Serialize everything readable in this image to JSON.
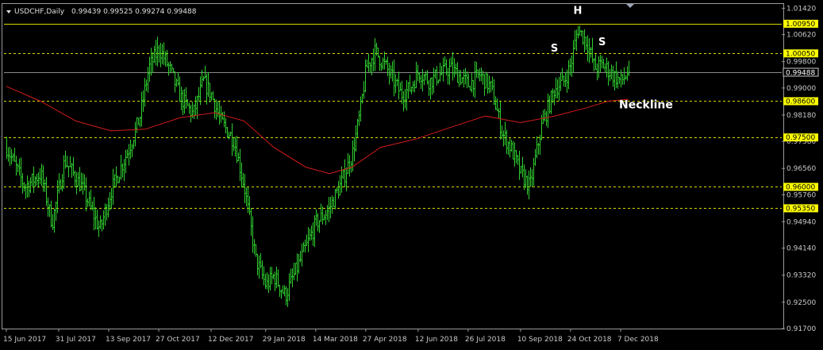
{
  "header": {
    "symbol_label": "USDCHF,Daily",
    "ohlc_label": "0.99439 0.99525 0.99274 0.99488"
  },
  "chart_data": {
    "type": "candlestick",
    "symbol": "USDCHF",
    "timeframe": "Daily",
    "ohlc": {
      "open": 0.99439,
      "high": 0.99525,
      "low": 0.99274,
      "close": 0.99488
    },
    "y_range": [
      0.917,
      1.0155
    ],
    "y_ticks": [
      "1.01420",
      "1.00620",
      "0.99800",
      "0.99000",
      "0.98180",
      "0.97380",
      "0.96560",
      "0.95760",
      "0.94940",
      "0.94140",
      "0.93320",
      "0.92500",
      "0.91700"
    ],
    "x_labels": [
      "15 Jun 2017",
      "31 Jul 2017",
      "13 Sep 2017",
      "27 Oct 2017",
      "12 Dec 2017",
      "29 Jan 2018",
      "14 Mar 2018",
      "27 Apr 2018",
      "12 Jun 2018",
      "26 Jul 2018",
      "10 Sep 2018",
      "24 Oct 2018",
      "7 Dec 2018"
    ],
    "levels": [
      {
        "value": 1.0095,
        "label": "1.00950",
        "style": "solid",
        "color": "#d8d800"
      },
      {
        "value": 1.0005,
        "label": "1.00050",
        "style": "dashed",
        "color": "#d8d800"
      },
      {
        "value": 0.986,
        "label": "0.98600",
        "style": "dashed",
        "color": "#d8d800"
      },
      {
        "value": 0.975,
        "label": "0.97500",
        "style": "dashed",
        "color": "#d8d800"
      },
      {
        "value": 0.96,
        "label": "0.96000",
        "style": "dashed",
        "color": "#d8d800"
      },
      {
        "value": 0.9535,
        "label": "0.95350",
        "style": "dashed",
        "color": "#d8d800"
      }
    ],
    "current_price": {
      "value": 0.99488,
      "label": "0.99488"
    },
    "annotations": [
      {
        "text": "H",
        "date": "30 Oct 2018",
        "price": 1.0125
      },
      {
        "text": "S",
        "date": "10 Oct 2018",
        "price": 1.001
      },
      {
        "text": "S",
        "date": "21 Nov 2018",
        "price": 1.003
      },
      {
        "text": "Neckline",
        "date": "14 Dec 2018",
        "price": 0.9838
      }
    ],
    "price_path": [
      [
        "15 Jun 2017",
        0.972
      ],
      [
        "1 Jul 2017",
        0.96
      ],
      [
        "15 Jul 2017",
        0.964
      ],
      [
        "25 Jul 2017",
        0.949
      ],
      [
        "5 Aug 2017",
        0.968
      ],
      [
        "20 Aug 2017",
        0.96
      ],
      [
        "5 Sep 2017",
        0.947
      ],
      [
        "15 Sep 2017",
        0.959
      ],
      [
        "1 Oct 2017",
        0.972
      ],
      [
        "10 Oct 2017",
        0.981
      ],
      [
        "18 Oct 2017",
        0.996
      ],
      [
        "27 Oct 2017",
        1.002
      ],
      [
        "5 Nov 2017",
        0.996
      ],
      [
        "15 Nov 2017",
        0.987
      ],
      [
        "26 Nov 2017",
        0.982
      ],
      [
        "5 Dec 2017",
        0.992
      ],
      [
        "12 Dec 2017",
        0.988
      ],
      [
        "20 Dec 2017",
        0.98
      ],
      [
        "1 Jan 2018",
        0.974
      ],
      [
        "10 Jan 2018",
        0.96
      ],
      [
        "20 Jan 2018",
        0.938
      ],
      [
        "29 Jan 2018",
        0.93
      ],
      [
        "5 Feb 2018",
        0.933
      ],
      [
        "15 Feb 2018",
        0.927
      ],
      [
        "26 Feb 2018",
        0.936
      ],
      [
        "8 Mar 2018",
        0.944
      ],
      [
        "14 Mar 2018",
        0.949
      ],
      [
        "25 Mar 2018",
        0.953
      ],
      [
        "5 Apr 2018",
        0.961
      ],
      [
        "15 Apr 2018",
        0.97
      ],
      [
        "22 Apr 2018",
        0.983
      ],
      [
        "27 Apr 2018",
        0.996
      ],
      [
        "5 May 2018",
        1.001
      ],
      [
        "15 May 2018",
        0.996
      ],
      [
        "28 May 2018",
        0.988
      ],
      [
        "5 Jun 2018",
        0.99
      ],
      [
        "12 Jun 2018",
        0.995
      ],
      [
        "22 Jun 2018",
        0.992
      ],
      [
        "30 Jun 2018",
        0.994
      ],
      [
        "10 Jul 2018",
        0.996
      ],
      [
        "20 Jul 2018",
        0.993
      ],
      [
        "26 Jul 2018",
        0.991
      ],
      [
        "5 Aug 2018",
        0.994
      ],
      [
        "15 Aug 2018",
        0.99
      ],
      [
        "25 Aug 2018",
        0.976
      ],
      [
        "1 Sep 2018",
        0.972
      ],
      [
        "10 Sep 2018",
        0.964
      ],
      [
        "18 Sep 2018",
        0.96
      ],
      [
        "28 Sep 2018",
        0.978
      ],
      [
        "10 Oct 2018",
        0.99
      ],
      [
        "18 Oct 2018",
        0.992
      ],
      [
        "24 Oct 2018",
        0.997
      ],
      [
        "30 Oct 2018",
        1.008
      ],
      [
        "7 Nov 2018",
        1.004
      ],
      [
        "14 Nov 2018",
        0.996
      ],
      [
        "21 Nov 2018",
        0.997
      ],
      [
        "30 Nov 2018",
        0.994
      ],
      [
        "7 Dec 2018",
        0.992
      ],
      [
        "14 Dec 2018",
        0.9949
      ]
    ],
    "moving_average": [
      [
        "15 Jun 2017",
        0.9905
      ],
      [
        "15 Jul 2017",
        0.986
      ],
      [
        "15 Aug 2017",
        0.98
      ],
      [
        "15 Sep 2017",
        0.977
      ],
      [
        "15 Oct 2017",
        0.9775
      ],
      [
        "15 Nov 2017",
        0.981
      ],
      [
        "15 Dec 2017",
        0.9825
      ],
      [
        "10 Jan 2018",
        0.98
      ],
      [
        "5 Feb 2018",
        0.972
      ],
      [
        "5 Mar 2018",
        0.966
      ],
      [
        "26 Mar 2018",
        0.964
      ],
      [
        "15 Apr 2018",
        0.966
      ],
      [
        "10 May 2018",
        0.972
      ],
      [
        "10 Jun 2018",
        0.9745
      ],
      [
        "10 Jul 2018",
        0.978
      ],
      [
        "10 Aug 2018",
        0.9815
      ],
      [
        "10 Sep 2018",
        0.9795
      ],
      [
        "10 Oct 2018",
        0.9815
      ],
      [
        "7 Nov 2018",
        0.984
      ],
      [
        "26 Nov 2018",
        0.986
      ],
      [
        "14 Dec 2018",
        0.9866
      ]
    ],
    "colors": {
      "background": "#000000",
      "bars": "#2fd12f",
      "moving_average": "#d21b1b",
      "levels": "#d8d800",
      "grid": "#9a9a9a",
      "text": "#c8c8c8"
    }
  }
}
